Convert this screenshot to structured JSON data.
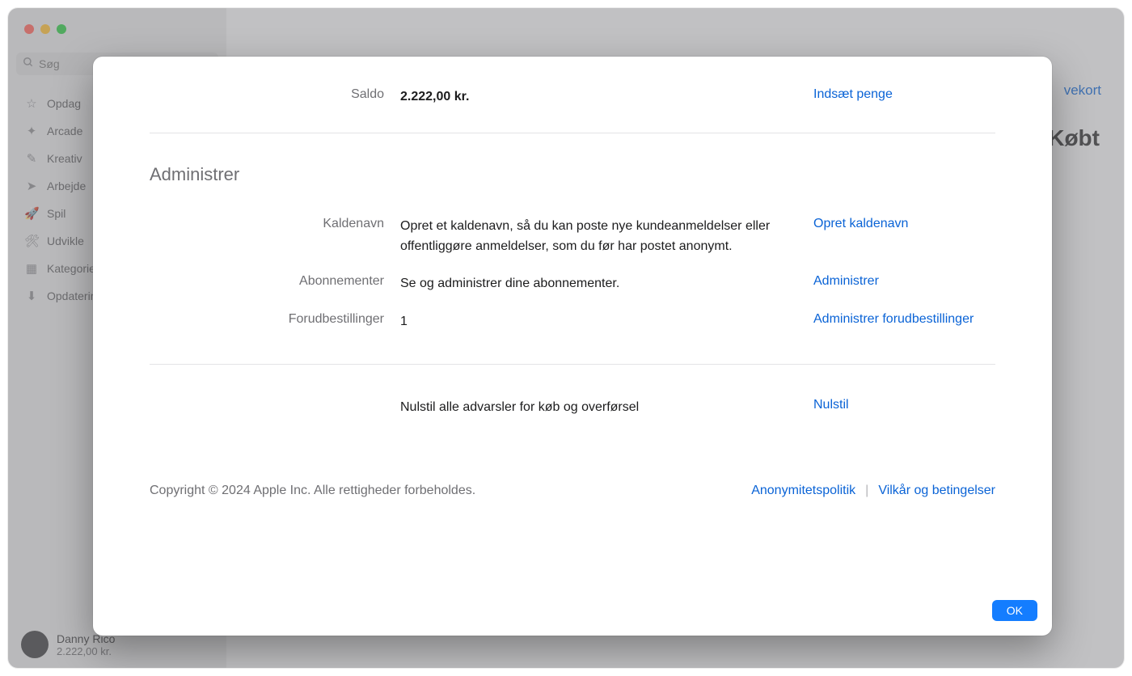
{
  "search": {
    "placeholder": "Søg"
  },
  "sidebar": {
    "items": [
      {
        "label": "Opdag",
        "icon": "☆"
      },
      {
        "label": "Arcade",
        "icon": "✦"
      },
      {
        "label": "Kreativ",
        "icon": "✎"
      },
      {
        "label": "Arbejde",
        "icon": "➤"
      },
      {
        "label": "Spil",
        "icon": "🚀"
      },
      {
        "label": "Udvikle",
        "icon": "🛠"
      },
      {
        "label": "Kategorier",
        "icon": "▦"
      },
      {
        "label": "Opdateringer",
        "icon": "⬇"
      }
    ]
  },
  "user": {
    "name": "Danny Rico",
    "balance": "2.222,00 kr."
  },
  "bg": {
    "link": "vekort",
    "title": "Købt"
  },
  "modal": {
    "balance": {
      "label": "Saldo",
      "value": "2.222,00 kr.",
      "action": "Indsæt penge"
    },
    "manage_title": "Administrer",
    "nickname": {
      "label": "Kaldenavn",
      "value": "Opret et kaldenavn, så du kan poste nye kundeanmeldelser eller offentliggøre anmeldelser, som du før har postet anonymt.",
      "action": "Opret kaldenavn"
    },
    "subscriptions": {
      "label": "Abonnementer",
      "value": "Se og administrer dine abonnementer.",
      "action": "Administrer"
    },
    "preorders": {
      "label": "Forudbestillinger",
      "value": "1",
      "action": "Administrer forudbestillinger"
    },
    "reset": {
      "value": "Nulstil alle advarsler for køb og overførsel",
      "action": "Nulstil"
    },
    "copyright": "Copyright © 2024 Apple Inc. Alle rettigheder forbeholdes.",
    "privacy": "Anonymitetspolitik",
    "terms": "Vilkår og betingelser",
    "sep": "|",
    "ok": "OK"
  }
}
